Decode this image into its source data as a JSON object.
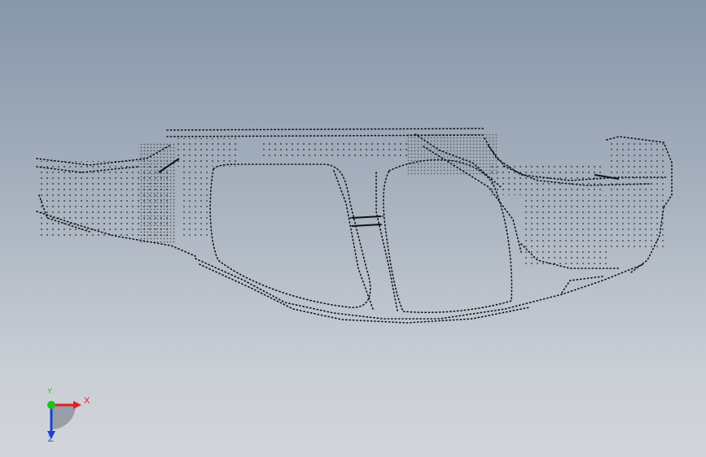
{
  "viewport": {
    "background_top": "#8796aa",
    "background_bottom": "#d2d5da",
    "point_color": "#101010"
  },
  "model": {
    "display_mode": "point-cloud",
    "icon": "car-body-frame-point-cloud"
  },
  "triad": {
    "x_label": "X",
    "y_label": "Y",
    "z_label": "Z",
    "x_color": "#e02020",
    "y_color": "#20c020",
    "z_color": "#2040d0"
  }
}
